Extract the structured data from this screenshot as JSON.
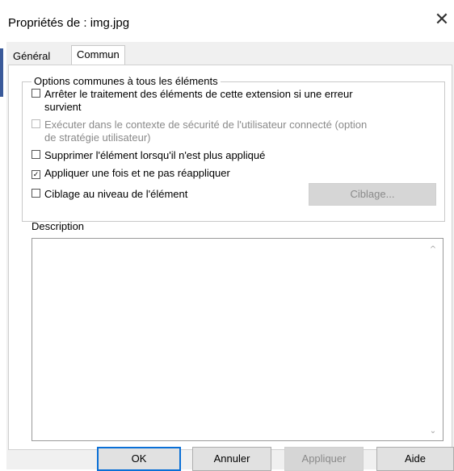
{
  "window": {
    "title": "Propriétés de : img.jpg"
  },
  "tabs": [
    {
      "label": "Général",
      "active": false
    },
    {
      "label": "Commun",
      "active": true
    }
  ],
  "options_group": {
    "legend": "Options communes à tous les éléments",
    "items": [
      {
        "label_line1": "Arrêter le traitement des éléments de cette extension si une erreur",
        "label_line2": "survient",
        "checked": false,
        "enabled": true
      },
      {
        "label_line1": "Exécuter dans le contexte de sécurité de l'utilisateur connecté (option",
        "label_line2": "de stratégie utilisateur)",
        "checked": false,
        "enabled": false
      },
      {
        "label_line1": "Supprimer l'élément lorsqu'il n'est plus appliqué",
        "checked": false,
        "enabled": true
      },
      {
        "label_line1": "Appliquer une fois et ne pas réappliquer",
        "checked": true,
        "enabled": true
      },
      {
        "label_line1": "Ciblage au niveau de l'élément",
        "checked": false,
        "enabled": true
      }
    ],
    "targeting_button": "Ciblage..."
  },
  "description": {
    "label": "Description",
    "value": ""
  },
  "footer": {
    "ok": "OK",
    "cancel": "Annuler",
    "apply": "Appliquer",
    "help": "Aide"
  },
  "icons": {
    "close": "close-icon",
    "scroll_up": "chevron-up-icon",
    "scroll_down": "chevron-down-icon",
    "checkbox_checked": "check-icon"
  },
  "colors": {
    "ok_focus": "#0a6fd6",
    "disabled_text": "#8a8a8a"
  }
}
